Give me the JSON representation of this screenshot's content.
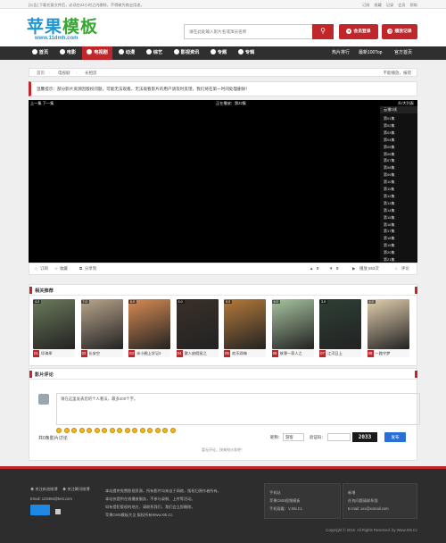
{
  "topbar": {
    "notice": "[公告] 下载任意文件后，必须在24小时之内删除，不得做为商业用途。",
    "links": [
      "订阅",
      "收藏",
      "记录",
      "会员",
      "帮助"
    ]
  },
  "logo": {
    "text_a": "苹果",
    "text_b": "模板",
    "url": "www.11dmh.com"
  },
  "search": {
    "placeholder": "请在此处输入影片名或演员名称",
    "button": "搜"
  },
  "header_buttons": {
    "login": "会员登录",
    "history": "播放记录"
  },
  "nav": {
    "items": [
      "首页",
      "电影",
      "电视剧",
      "动漫",
      "综艺",
      "影视资讯",
      "专题",
      "专辑"
    ],
    "right": [
      "热片排行",
      "最新100Top",
      "官方首页"
    ]
  },
  "breadcrumb": {
    "items": [
      "首页",
      "电视剧",
      "长相思"
    ],
    "right": "不能播放，报错"
  },
  "notice": "温馨提示：部分影片资源因版权问题，可能无法观看。无法观看影片的用户请及时反馈，我们将在第一时间处理删除！",
  "player": {
    "prev_next": "上一集  下一集",
    "now_playing": "正在播放：第22集",
    "order": "升/大列表",
    "source": "云播1线",
    "episodes": [
      "第01集",
      "第02集",
      "第03集",
      "第04集",
      "第05集",
      "第06集",
      "第07集",
      "第08集",
      "第09集",
      "第10集",
      "第11集",
      "第12集",
      "第13集",
      "第14集",
      "第15集",
      "第16集",
      "第17集",
      "第18集",
      "第19集",
      "第20集",
      "第21集"
    ]
  },
  "toolbar": {
    "left": [
      "订阅",
      "收藏",
      "分享到"
    ],
    "like": "0",
    "dislike": "0",
    "plays": "播放 563次",
    "comment": "评论"
  },
  "related": {
    "title": "相关推荐",
    "items": [
      {
        "num": "01",
        "title": "珍珠季",
        "badge": "4.0"
      },
      {
        "num": "02",
        "title": "长安空",
        "badge": "7.0"
      },
      {
        "num": "03",
        "title": "米小圈上学记2",
        "badge": "6.0"
      },
      {
        "num": "04",
        "title": "傲人放假鼠之",
        "badge": "8.0"
      },
      {
        "num": "05",
        "title": "欢乐颂嗨",
        "badge": "9.0"
      },
      {
        "num": "06",
        "title": "放课一家人之",
        "badge": "4.0"
      },
      {
        "num": "07",
        "title": "江河日上",
        "badge": "3.0"
      },
      {
        "num": "08",
        "title": "一路守梦",
        "badge": "4.0"
      }
    ],
    "colors": [
      "#6a7a5b",
      "#b9a58c",
      "#d88b54",
      "#3a3028",
      "#b47a3a",
      "#a8c4a0",
      "#2e3f35",
      "#e2cfae"
    ]
  },
  "comments": {
    "title": "影片评论",
    "placeholder": "请在这里发表您的个人看法，最多200个字。",
    "count_label": "共0条影片讨论",
    "nickname_label": "昵称：",
    "nickname_value": "游客",
    "captcha_label": "验证码：",
    "captcha_image": "2033",
    "submit": "发布",
    "empty_note": "暂无评论，快来抢沙发吧！"
  },
  "footer": {
    "col1": [
      "关注新浪微博",
      "关注腾讯微博",
      "Email: 123456@test.com"
    ],
    "col2": [
      "本站提供免费影视资源，所有影片均来自于网络，版权归原作者所有。",
      "本站仅提供在线播放服务，不参与录制、上传等活动。",
      "如有侵犯版权的地方，请联系我们，我们会立即删除。",
      "苹果CMS模板大全 版权所有Www.X6i.Cc"
    ],
    "col3": [
      "手机站",
      "苹果CMS视频模板",
      "手机观看：V.X6i.Cc"
    ],
    "col4": [
      "新增",
      "任何问题请联系我",
      "E-mail: xxx@xxmail.com"
    ],
    "copyright": "Copyright © 2015. All Rights Reserved. by Www.X6i.Cc"
  }
}
